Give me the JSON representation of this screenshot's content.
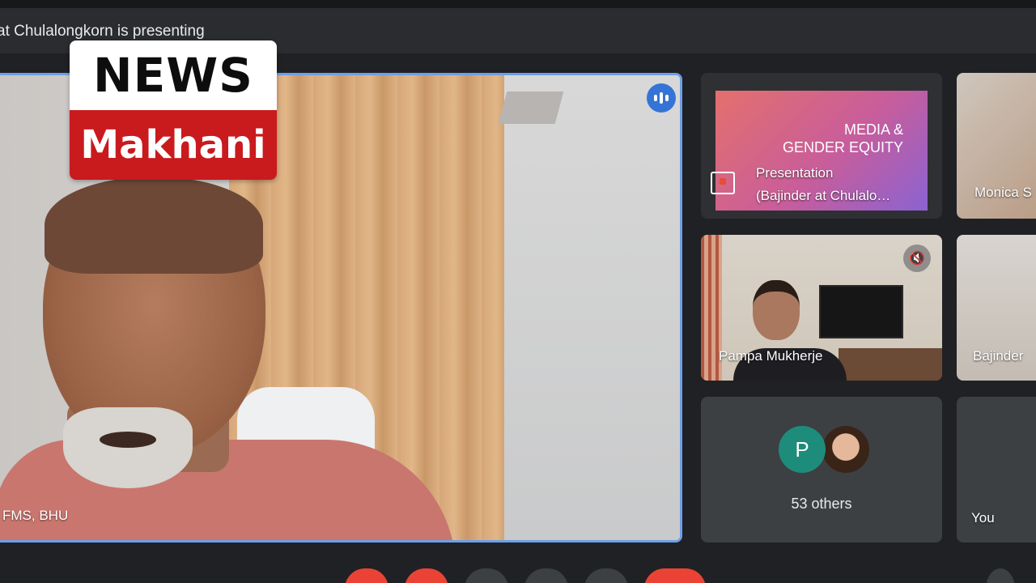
{
  "header": {
    "presenting_text": "at Chulalongkorn is presenting"
  },
  "watermark": {
    "line1": "NEWS",
    "line2": "Makhani"
  },
  "main_speaker": {
    "name": "FMS, BHU"
  },
  "presentation_tile": {
    "slide_line1": "MEDIA &",
    "slide_line2": "GENDER EQUITY",
    "label_line1": "Presentation",
    "label_line2": "(Bajinder at Chulalo…"
  },
  "participants": [
    {
      "name": "Monica S"
    },
    {
      "name": "Pampa Mukherje"
    },
    {
      "name": "Bajinder"
    }
  ],
  "others_tile": {
    "avatar_initial": "P",
    "count_label": "53 others"
  },
  "self_tile": {
    "label": "You"
  },
  "colors": {
    "speaking_blue": "#3574d6",
    "end_call_red": "#ea4335",
    "tile_bg": "#3c4043",
    "logo_red": "#c91a1e"
  }
}
